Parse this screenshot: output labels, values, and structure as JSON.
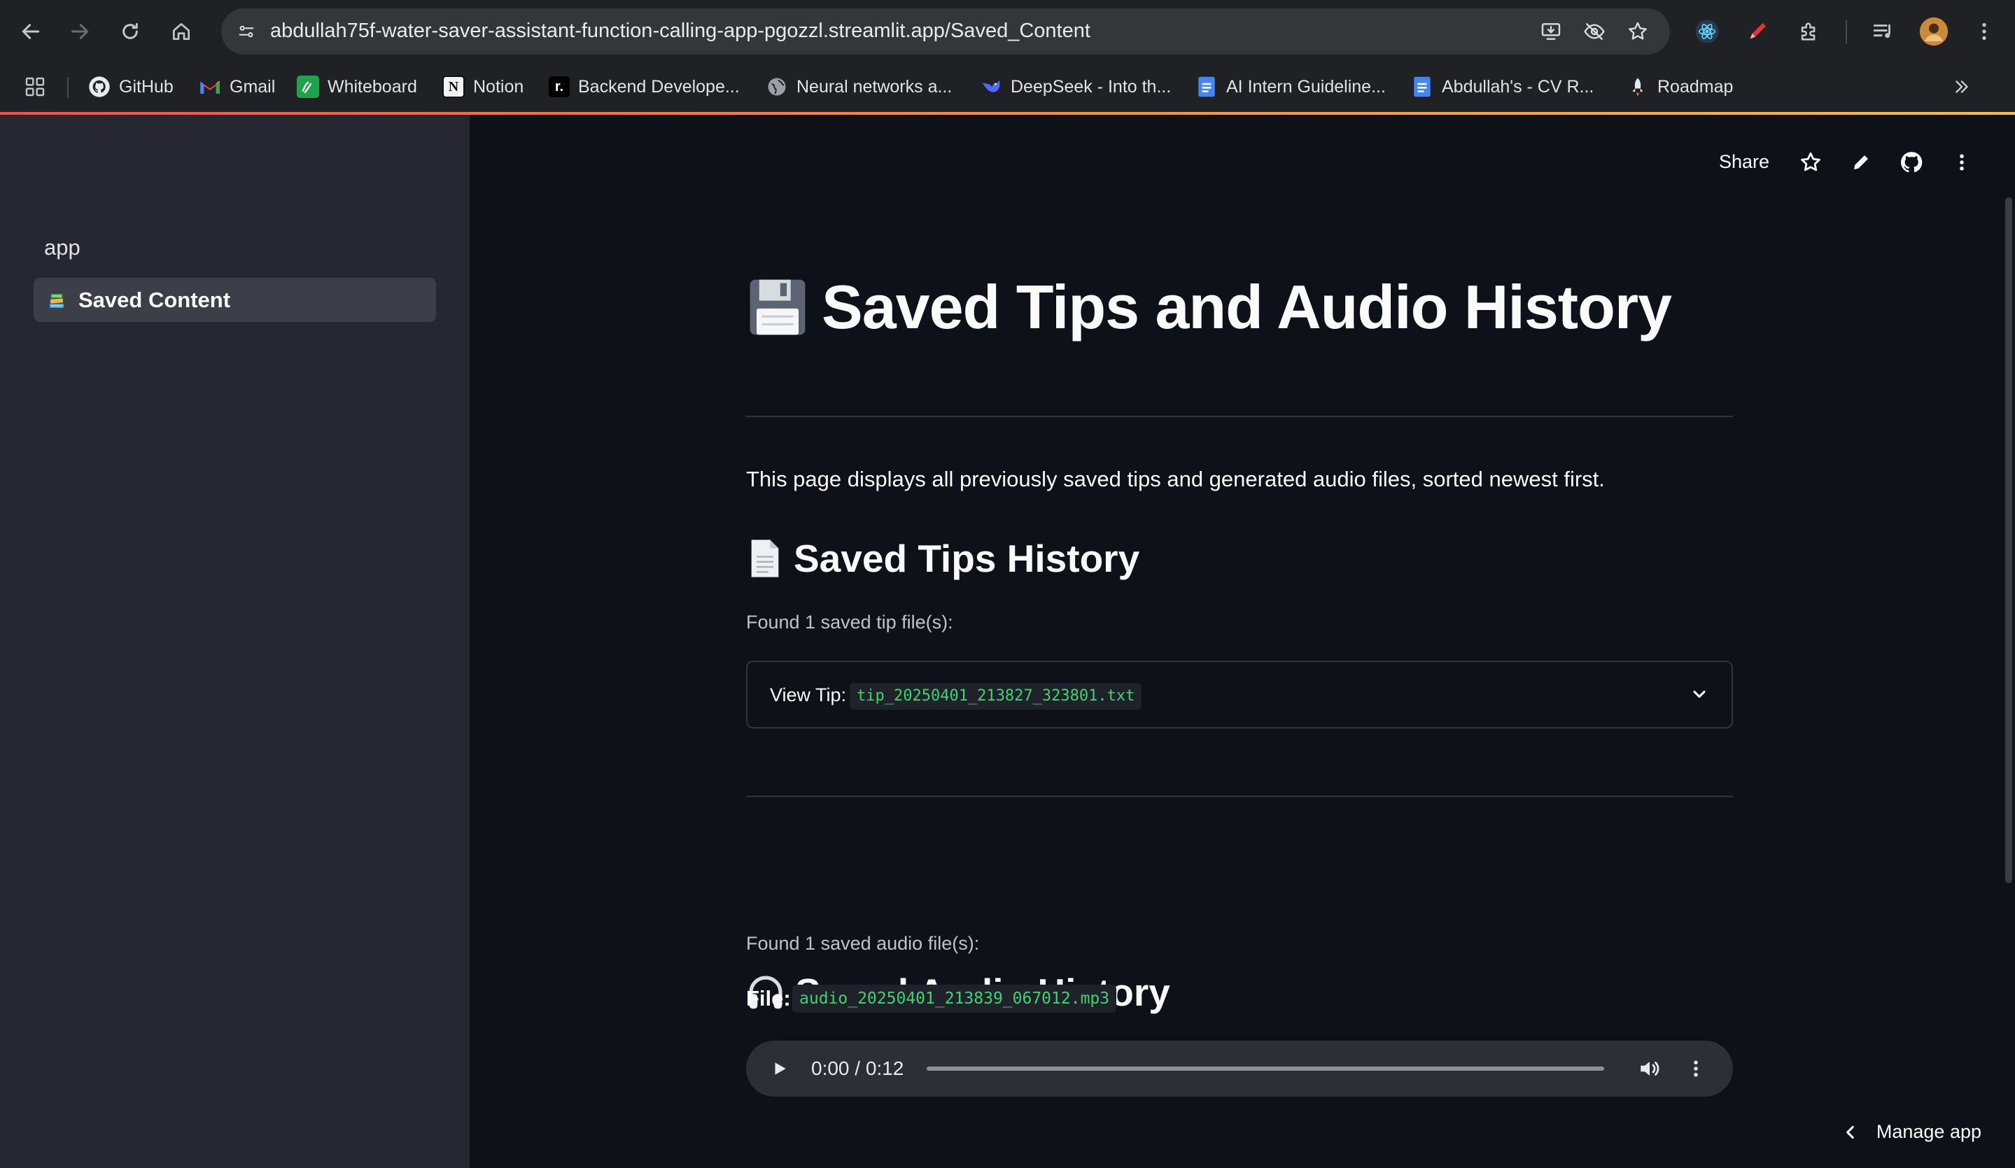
{
  "browser": {
    "url": "abdullah75f-water-saver-assistant-function-calling-app-pgozzl.streamlit.app/Saved_Content",
    "bookmarks": [
      {
        "label": "GitHub",
        "icon": "github-icon"
      },
      {
        "label": "Gmail",
        "icon": "gmail-icon"
      },
      {
        "label": "Whiteboard",
        "icon": "whiteboard-icon"
      },
      {
        "label": "Notion",
        "icon": "notion-icon"
      },
      {
        "label": "Backend Develope...",
        "icon": "roadmap-r-icon"
      },
      {
        "label": "Neural networks a...",
        "icon": "globe-icon"
      },
      {
        "label": "DeepSeek - Into th...",
        "icon": "deepseek-icon"
      },
      {
        "label": "AI Intern Guideline...",
        "icon": "docs-icon"
      },
      {
        "label": "Abdullah's - CV R...",
        "icon": "docs-icon"
      },
      {
        "label": "Roadmap",
        "icon": "rocket-icon"
      }
    ]
  },
  "sidebar": {
    "app_label": "app",
    "items": [
      {
        "label": "Saved Content",
        "icon": "books-icon",
        "active": true
      }
    ]
  },
  "toolbar": {
    "share_label": "Share"
  },
  "main": {
    "title": "Saved Tips and Audio History",
    "title_icon": "floppy-disk-icon",
    "intro": "This page displays all previously saved tips and generated audio files, sorted newest first.",
    "tips_section": {
      "heading": "Saved Tips History",
      "icon": "page-icon",
      "caption": "Found 1 saved tip file(s):",
      "expander_label": "View Tip:",
      "expander_file": "tip_20250401_213827_323801.txt"
    },
    "audio_section": {
      "heading": "Saved Audio History",
      "icon": "headphones-icon",
      "caption": "Found 1 saved audio file(s):",
      "file_label": "File:",
      "file_name": "audio_20250401_213839_067012.mp3",
      "player_time": "0:00 / 0:12"
    }
  },
  "manage_app_label": "Manage app",
  "colors": {
    "background": "#0e1117",
    "sidebar": "#262730",
    "code_text": "#3dd56d",
    "accent_start": "#ff4b4b",
    "accent_end": "#ffbd45"
  }
}
